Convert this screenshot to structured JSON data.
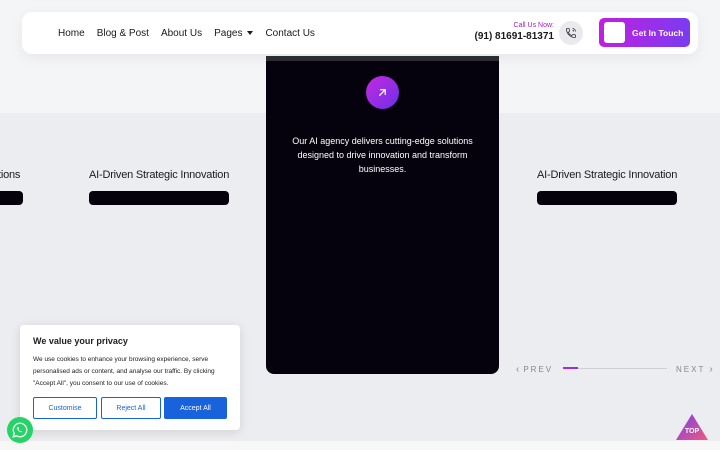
{
  "nav": {
    "items": [
      {
        "label": "Home"
      },
      {
        "label": "Blog & Post"
      },
      {
        "label": "About Us"
      },
      {
        "label": "Pages"
      },
      {
        "label": "Contact Us"
      }
    ]
  },
  "contact": {
    "call_label": "Call Us Now:",
    "phone": "(91) 81691-81371",
    "cta_label": "Get In Touch"
  },
  "slides": {
    "left_title": "tions",
    "center_text": "Our AI agency delivers cutting-edge solutions designed to drive innovation and transform businesses.",
    "side_title": "AI-Driven Strategic Innovation",
    "right_title": "AI-Driven Strategic Innovation"
  },
  "slider": {
    "prev_label": "PREV",
    "next_label": "NEXT",
    "progress": 0.14
  },
  "cookie": {
    "title": "We value your privacy",
    "text": "We use cookies to enhance your browsing experience, serve personalised ads or content, and analyse our traffic. By clicking \"Accept All\", you consent to our use of cookies.",
    "customise_label": "Customise",
    "reject_label": "Reject All",
    "accept_label": "Accept All"
  },
  "scroll_top_label": "TOP",
  "colors": {
    "accent_start": "#c11fe0",
    "accent_end": "#7a3cf0",
    "card_bg": "#06020d",
    "cookie_blue": "#1863dc",
    "whatsapp": "#25d366"
  }
}
